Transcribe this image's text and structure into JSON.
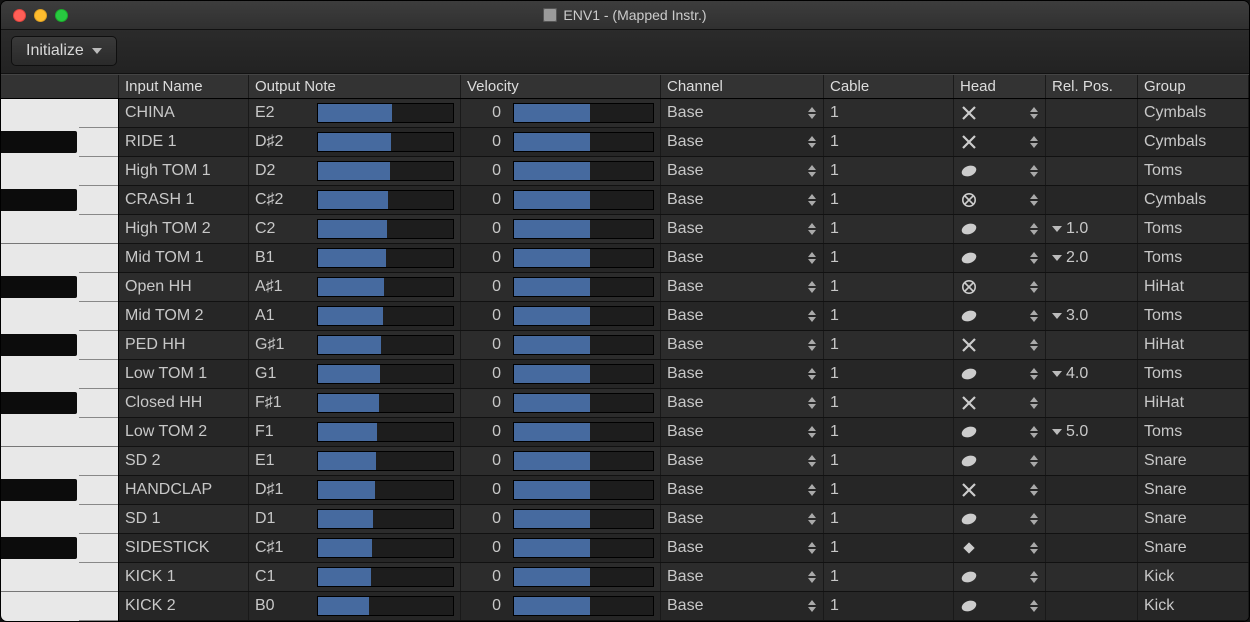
{
  "window": {
    "title": "ENV1 - (Mapped Instr.)"
  },
  "toolbar": {
    "initialize_label": "Initialize"
  },
  "columns": {
    "input": "Input Name",
    "output": "Output Note",
    "velocity": "Velocity",
    "channel": "Channel",
    "cable": "Cable",
    "head": "Head",
    "relpos": "Rel. Pos.",
    "group": "Group"
  },
  "rows": [
    {
      "input": "CHINA",
      "note": "E2",
      "bar": 0.55,
      "vel": 0,
      "vbar": 0.55,
      "chan": "Base",
      "cable": "1",
      "head": "x",
      "rel": "",
      "group": "Cymbals"
    },
    {
      "input": "RIDE 1",
      "note": "D♯2",
      "bar": 0.54,
      "vel": 0,
      "vbar": 0.55,
      "chan": "Base",
      "cable": "1",
      "head": "x",
      "rel": "",
      "group": "Cymbals"
    },
    {
      "input": "High TOM 1",
      "note": "D2",
      "bar": 0.53,
      "vel": 0,
      "vbar": 0.55,
      "chan": "Base",
      "cable": "1",
      "head": "oval",
      "rel": "",
      "group": "Toms"
    },
    {
      "input": "CRASH 1",
      "note": "C♯2",
      "bar": 0.52,
      "vel": 0,
      "vbar": 0.55,
      "chan": "Base",
      "cable": "1",
      "head": "circlex",
      "rel": "",
      "group": "Cymbals"
    },
    {
      "input": "High TOM 2",
      "note": "C2",
      "bar": 0.51,
      "vel": 0,
      "vbar": 0.55,
      "chan": "Base",
      "cable": "1",
      "head": "oval",
      "rel": "1.0",
      "group": "Toms"
    },
    {
      "input": "Mid TOM 1",
      "note": "B1",
      "bar": 0.5,
      "vel": 0,
      "vbar": 0.55,
      "chan": "Base",
      "cable": "1",
      "head": "oval",
      "rel": "2.0",
      "group": "Toms"
    },
    {
      "input": "Open HH",
      "note": "A♯1",
      "bar": 0.49,
      "vel": 0,
      "vbar": 0.55,
      "chan": "Base",
      "cable": "1",
      "head": "circlex",
      "rel": "",
      "group": "HiHat"
    },
    {
      "input": "Mid TOM 2",
      "note": "A1",
      "bar": 0.48,
      "vel": 0,
      "vbar": 0.55,
      "chan": "Base",
      "cable": "1",
      "head": "oval",
      "rel": "3.0",
      "group": "Toms"
    },
    {
      "input": "PED HH",
      "note": "G♯1",
      "bar": 0.47,
      "vel": 0,
      "vbar": 0.55,
      "chan": "Base",
      "cable": "1",
      "head": "x",
      "rel": "",
      "group": "HiHat"
    },
    {
      "input": "Low TOM 1",
      "note": "G1",
      "bar": 0.46,
      "vel": 0,
      "vbar": 0.55,
      "chan": "Base",
      "cable": "1",
      "head": "oval",
      "rel": "4.0",
      "group": "Toms"
    },
    {
      "input": "Closed HH",
      "note": "F♯1",
      "bar": 0.45,
      "vel": 0,
      "vbar": 0.55,
      "chan": "Base",
      "cable": "1",
      "head": "x",
      "rel": "",
      "group": "HiHat"
    },
    {
      "input": "Low TOM 2",
      "note": "F1",
      "bar": 0.44,
      "vel": 0,
      "vbar": 0.55,
      "chan": "Base",
      "cable": "1",
      "head": "oval",
      "rel": "5.0",
      "group": "Toms"
    },
    {
      "input": "SD 2",
      "note": "E1",
      "bar": 0.43,
      "vel": 0,
      "vbar": 0.55,
      "chan": "Base",
      "cable": "1",
      "head": "oval",
      "rel": "",
      "group": "Snare"
    },
    {
      "input": "HANDCLAP",
      "note": "D♯1",
      "bar": 0.42,
      "vel": 0,
      "vbar": 0.55,
      "chan": "Base",
      "cable": "1",
      "head": "x",
      "rel": "",
      "group": "Snare"
    },
    {
      "input": "SD 1",
      "note": "D1",
      "bar": 0.41,
      "vel": 0,
      "vbar": 0.55,
      "chan": "Base",
      "cable": "1",
      "head": "oval",
      "rel": "",
      "group": "Snare"
    },
    {
      "input": "SIDESTICK",
      "note": "C♯1",
      "bar": 0.4,
      "vel": 0,
      "vbar": 0.55,
      "chan": "Base",
      "cable": "1",
      "head": "diamond",
      "rel": "",
      "group": "Snare"
    },
    {
      "input": "KICK 1",
      "note": "C1",
      "bar": 0.39,
      "vel": 0,
      "vbar": 0.55,
      "chan": "Base",
      "cable": "1",
      "head": "oval",
      "rel": "",
      "group": "Kick"
    },
    {
      "input": "KICK 2",
      "note": "B0",
      "bar": 0.38,
      "vel": 0,
      "vbar": 0.55,
      "chan": "Base",
      "cable": "1",
      "head": "oval",
      "rel": "",
      "group": "Kick"
    }
  ]
}
